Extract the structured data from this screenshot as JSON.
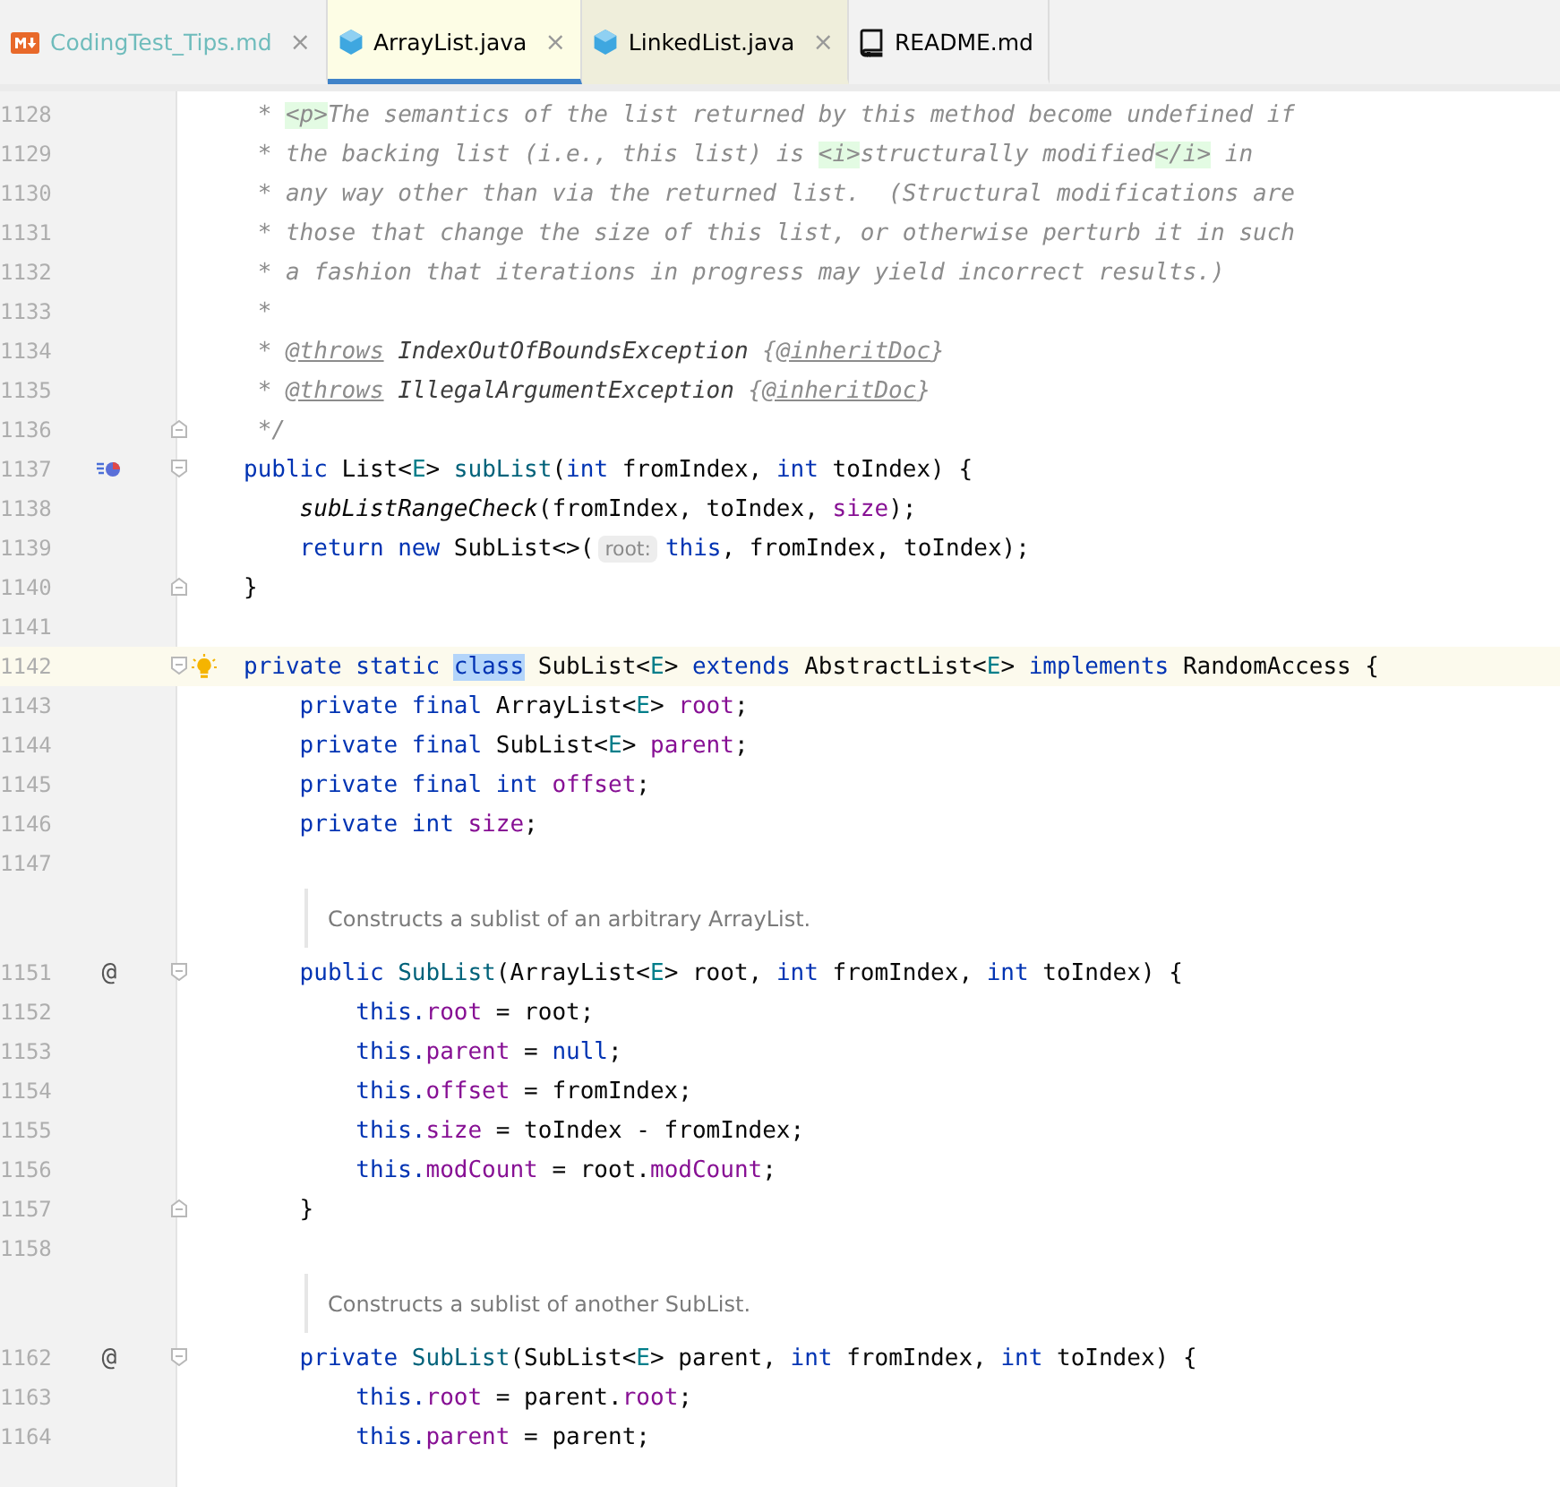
{
  "tabs": [
    {
      "label": "CodingTest_Tips.md",
      "kind": "markdown",
      "selected": false,
      "tinted_label": true,
      "color": "#f2f2f2",
      "close": "×"
    },
    {
      "label": "ArrayList.java",
      "kind": "java",
      "selected": true,
      "tinted_label": false,
      "color": "#fdfde5",
      "close": "×"
    },
    {
      "label": "LinkedList.java",
      "kind": "java",
      "selected": false,
      "tinted_label": false,
      "color": "#efeedb",
      "close": "×"
    },
    {
      "label": "README.md",
      "kind": "readme",
      "selected": false,
      "tinted_label": false,
      "color": "#f2f2f2"
    }
  ],
  "lines": [
    {
      "kind": "code",
      "number": "1128",
      "tokens": [
        {
          "kind": "comment",
          "text": " * "
        },
        {
          "kind": "tag",
          "text": "<p>"
        },
        {
          "kind": "comment",
          "text": "The semantics of the list returned by this method become undefined if"
        }
      ]
    },
    {
      "kind": "code",
      "number": "1129",
      "tokens": [
        {
          "kind": "comment",
          "text": " * the backing list (i.e., this list) is "
        },
        {
          "kind": "tag",
          "text": "<i>"
        },
        {
          "kind": "comment",
          "text": "structurally modified"
        },
        {
          "kind": "tag",
          "text": "</i>"
        },
        {
          "kind": "comment",
          "text": " in"
        }
      ]
    },
    {
      "kind": "code",
      "number": "1130",
      "tokens": [
        {
          "kind": "comment",
          "text": " * any way other than via the returned list.  (Structural modifications are"
        }
      ]
    },
    {
      "kind": "code",
      "number": "1131",
      "tokens": [
        {
          "kind": "comment",
          "text": " * those that change the size of this list, or otherwise perturb it in such"
        }
      ]
    },
    {
      "kind": "code",
      "number": "1132",
      "tokens": [
        {
          "kind": "comment",
          "text": " * a fashion that iterations in progress may yield incorrect results.)"
        }
      ]
    },
    {
      "kind": "code",
      "number": "1133",
      "tokens": [
        {
          "kind": "comment",
          "text": " *"
        }
      ]
    },
    {
      "kind": "code",
      "number": "1134",
      "tokens": [
        {
          "kind": "comment",
          "text": " * "
        },
        {
          "kind": "doctag",
          "text": "@throws"
        },
        {
          "kind": "ref",
          "text": " IndexOutOfBoundsException"
        },
        {
          "kind": "comment",
          "text": " {"
        },
        {
          "kind": "doctag",
          "text": "@inheritDoc"
        },
        {
          "kind": "comment",
          "text": "}"
        }
      ]
    },
    {
      "kind": "code",
      "number": "1135",
      "tokens": [
        {
          "kind": "comment",
          "text": " * "
        },
        {
          "kind": "doctag",
          "text": "@throws"
        },
        {
          "kind": "ref",
          "text": " IllegalArgumentException"
        },
        {
          "kind": "comment",
          "text": " {"
        },
        {
          "kind": "doctag",
          "text": "@inheritDoc"
        },
        {
          "kind": "comment",
          "text": "}"
        }
      ]
    },
    {
      "kind": "code",
      "number": "1136",
      "fold_end": true,
      "tokens": [
        {
          "kind": "comment",
          "text": " */"
        }
      ]
    },
    {
      "kind": "code",
      "number": "1137",
      "fold_start": true,
      "override": true,
      "tokens": [
        {
          "kind": "keyword",
          "text": "public "
        },
        {
          "kind": "plain",
          "text": "List<"
        },
        {
          "kind": "type-param",
          "text": "E"
        },
        {
          "kind": "plain",
          "text": "> "
        },
        {
          "kind": "method",
          "text": "subList"
        },
        {
          "kind": "plain",
          "text": "("
        },
        {
          "kind": "keyword",
          "text": "int "
        },
        {
          "kind": "plain",
          "text": "fromIndex, "
        },
        {
          "kind": "keyword",
          "text": "int "
        },
        {
          "kind": "plain",
          "text": "toIndex) {"
        }
      ]
    },
    {
      "kind": "code",
      "number": "1138",
      "tokens": [
        {
          "kind": "static-call",
          "text": "    subListRangeCheck"
        },
        {
          "kind": "plain",
          "text": "(fromIndex, toIndex, "
        },
        {
          "kind": "field",
          "text": "size"
        },
        {
          "kind": "plain",
          "text": ");"
        }
      ]
    },
    {
      "kind": "code",
      "number": "1139",
      "tokens": [
        {
          "kind": "keyword",
          "text": "    return new "
        },
        {
          "kind": "plain",
          "text": "SubList<>("
        },
        {
          "kind": "hint",
          "text": "root:"
        },
        {
          "kind": "keyword",
          "text": "this"
        },
        {
          "kind": "plain",
          "text": ", fromIndex, toIndex);"
        }
      ]
    },
    {
      "kind": "code",
      "number": "1140",
      "fold_end": true,
      "tokens": [
        {
          "kind": "plain",
          "text": "}"
        }
      ]
    },
    {
      "kind": "code",
      "number": "1141"
    },
    {
      "kind": "code",
      "number": "1142",
      "current": true,
      "fold_start": true,
      "intention": true,
      "tokens": [
        {
          "kind": "keyword",
          "text": "private static "
        },
        {
          "kind": "match",
          "text": "class"
        },
        {
          "kind": "plain",
          "text": " SubList<"
        },
        {
          "kind": "type-param",
          "text": "E"
        },
        {
          "kind": "plain",
          "text": "> "
        },
        {
          "kind": "keyword",
          "text": "extends "
        },
        {
          "kind": "plain",
          "text": "AbstractList<"
        },
        {
          "kind": "type-param",
          "text": "E"
        },
        {
          "kind": "plain",
          "text": "> "
        },
        {
          "kind": "keyword",
          "text": "implements "
        },
        {
          "kind": "plain",
          "text": "RandomAccess {"
        }
      ]
    },
    {
      "kind": "code",
      "number": "1143",
      "tokens": [
        {
          "kind": "keyword",
          "text": "    private final "
        },
        {
          "kind": "plain",
          "text": "ArrayList<"
        },
        {
          "kind": "type-param",
          "text": "E"
        },
        {
          "kind": "plain",
          "text": "> "
        },
        {
          "kind": "field",
          "text": "root"
        },
        {
          "kind": "plain",
          "text": ";"
        }
      ]
    },
    {
      "kind": "code",
      "number": "1144",
      "tokens": [
        {
          "kind": "keyword",
          "text": "    private final "
        },
        {
          "kind": "plain",
          "text": "SubList<"
        },
        {
          "kind": "type-param",
          "text": "E"
        },
        {
          "kind": "plain",
          "text": "> "
        },
        {
          "kind": "field",
          "text": "parent"
        },
        {
          "kind": "plain",
          "text": ";"
        }
      ]
    },
    {
      "kind": "code",
      "number": "1145",
      "tokens": [
        {
          "kind": "keyword",
          "text": "    private final int "
        },
        {
          "kind": "field",
          "text": "offset"
        },
        {
          "kind": "plain",
          "text": ";"
        }
      ]
    },
    {
      "kind": "code",
      "number": "1146",
      "tokens": [
        {
          "kind": "keyword",
          "text": "    private int "
        },
        {
          "kind": "field",
          "text": "size"
        },
        {
          "kind": "plain",
          "text": ";"
        }
      ]
    },
    {
      "kind": "code",
      "number": "1147"
    },
    {
      "kind": "doc",
      "text": "Constructs a sublist of an arbitrary ArrayList."
    },
    {
      "kind": "code",
      "number": "1151",
      "fold_start": true,
      "gutter_text": "@",
      "tokens": [
        {
          "kind": "keyword",
          "text": "    public "
        },
        {
          "kind": "method",
          "text": "SubList"
        },
        {
          "kind": "plain",
          "text": "(ArrayList<"
        },
        {
          "kind": "type-param",
          "text": "E"
        },
        {
          "kind": "plain",
          "text": "> root, "
        },
        {
          "kind": "keyword",
          "text": "int "
        },
        {
          "kind": "plain",
          "text": "fromIndex, "
        },
        {
          "kind": "keyword",
          "text": "int "
        },
        {
          "kind": "plain",
          "text": "toIndex) {"
        }
      ]
    },
    {
      "kind": "code",
      "number": "1152",
      "tokens": [
        {
          "kind": "keyword",
          "text": "        this."
        },
        {
          "kind": "field",
          "text": "root"
        },
        {
          "kind": "plain",
          "text": " = root;"
        }
      ]
    },
    {
      "kind": "code",
      "number": "1153",
      "tokens": [
        {
          "kind": "keyword",
          "text": "        this."
        },
        {
          "kind": "field",
          "text": "parent"
        },
        {
          "kind": "plain",
          "text": " = "
        },
        {
          "kind": "keyword",
          "text": "null"
        },
        {
          "kind": "plain",
          "text": ";"
        }
      ]
    },
    {
      "kind": "code",
      "number": "1154",
      "tokens": [
        {
          "kind": "keyword",
          "text": "        this."
        },
        {
          "kind": "field",
          "text": "offset"
        },
        {
          "kind": "plain",
          "text": " = fromIndex;"
        }
      ]
    },
    {
      "kind": "code",
      "number": "1155",
      "tokens": [
        {
          "kind": "keyword",
          "text": "        this."
        },
        {
          "kind": "field",
          "text": "size"
        },
        {
          "kind": "plain",
          "text": " = toIndex - fromIndex;"
        }
      ]
    },
    {
      "kind": "code",
      "number": "1156",
      "tokens": [
        {
          "kind": "keyword",
          "text": "        this."
        },
        {
          "kind": "field",
          "text": "modCount"
        },
        {
          "kind": "plain",
          "text": " = root."
        },
        {
          "kind": "field",
          "text": "modCount"
        },
        {
          "kind": "plain",
          "text": ";"
        }
      ]
    },
    {
      "kind": "code",
      "number": "1157",
      "fold_end": true,
      "tokens": [
        {
          "kind": "plain",
          "text": "    }"
        }
      ]
    },
    {
      "kind": "code",
      "number": "1158"
    },
    {
      "kind": "doc",
      "text": "Constructs a sublist of another SubList."
    },
    {
      "kind": "code",
      "number": "1162",
      "fold_start": true,
      "gutter_text": "@",
      "tokens": [
        {
          "kind": "keyword",
          "text": "    private "
        },
        {
          "kind": "method",
          "text": "SubList"
        },
        {
          "kind": "plain",
          "text": "(SubList<"
        },
        {
          "kind": "type-param",
          "text": "E"
        },
        {
          "kind": "plain",
          "text": "> parent, "
        },
        {
          "kind": "keyword",
          "text": "int "
        },
        {
          "kind": "plain",
          "text": "fromIndex, "
        },
        {
          "kind": "keyword",
          "text": "int "
        },
        {
          "kind": "plain",
          "text": "toIndex) {"
        }
      ]
    },
    {
      "kind": "code",
      "number": "1163",
      "tokens": [
        {
          "kind": "keyword",
          "text": "        this."
        },
        {
          "kind": "field",
          "text": "root"
        },
        {
          "kind": "plain",
          "text": " = parent."
        },
        {
          "kind": "field",
          "text": "root"
        },
        {
          "kind": "plain",
          "text": ";"
        }
      ]
    },
    {
      "kind": "code",
      "number": "1164",
      "tokens": [
        {
          "kind": "keyword",
          "text": "        this."
        },
        {
          "kind": "field",
          "text": "parent"
        },
        {
          "kind": "plain",
          "text": " = parent;"
        }
      ]
    }
  ]
}
